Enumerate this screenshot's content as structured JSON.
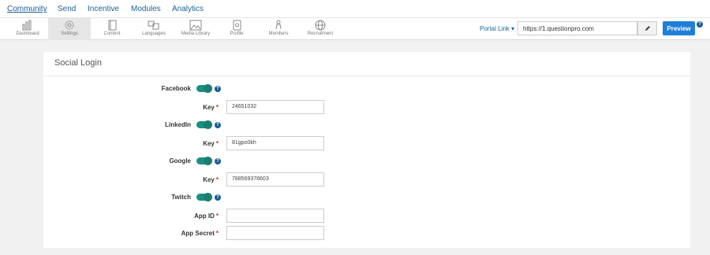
{
  "topnav": [
    "Community",
    "Send",
    "Incentive",
    "Modules",
    "Analytics"
  ],
  "toolbar": [
    {
      "label": "Dashboard",
      "icon": "bar-chart-icon"
    },
    {
      "label": "Settings",
      "icon": "gear-icon"
    },
    {
      "label": "Content",
      "icon": "document-icon"
    },
    {
      "label": "Languages",
      "icon": "translate-icon"
    },
    {
      "label": "Media Library",
      "icon": "image-icon"
    },
    {
      "label": "Profile",
      "icon": "profile-icon"
    },
    {
      "label": "Members",
      "icon": "person-icon"
    },
    {
      "label": "Recruitment",
      "icon": "globe-icon"
    }
  ],
  "header": {
    "portal_link": "Portal Link",
    "portal_url": "https://1.questionpro.com",
    "preview": "Preview",
    "help": "?"
  },
  "panel": {
    "title": "Social Login",
    "help": "?",
    "facebook": "Facebook",
    "facebook_key_label": "Key",
    "facebook_key": "24651032",
    "linkedin": "LinkedIn",
    "linkedin_key_label": "Key",
    "linkedin_key": "81gpo0kh",
    "google": "Google",
    "google_key_label": "Key",
    "google_key": "788569378603",
    "twitch": "Twitch",
    "app_id_label": "App ID",
    "app_id": "",
    "app_secret_label": "App Secret",
    "app_secret": "",
    "required_mark": "*"
  },
  "colors": {
    "accent": "#1f7fd8",
    "toggle": "#1a9080",
    "link": "#1a6496",
    "required": "#c9302c"
  }
}
